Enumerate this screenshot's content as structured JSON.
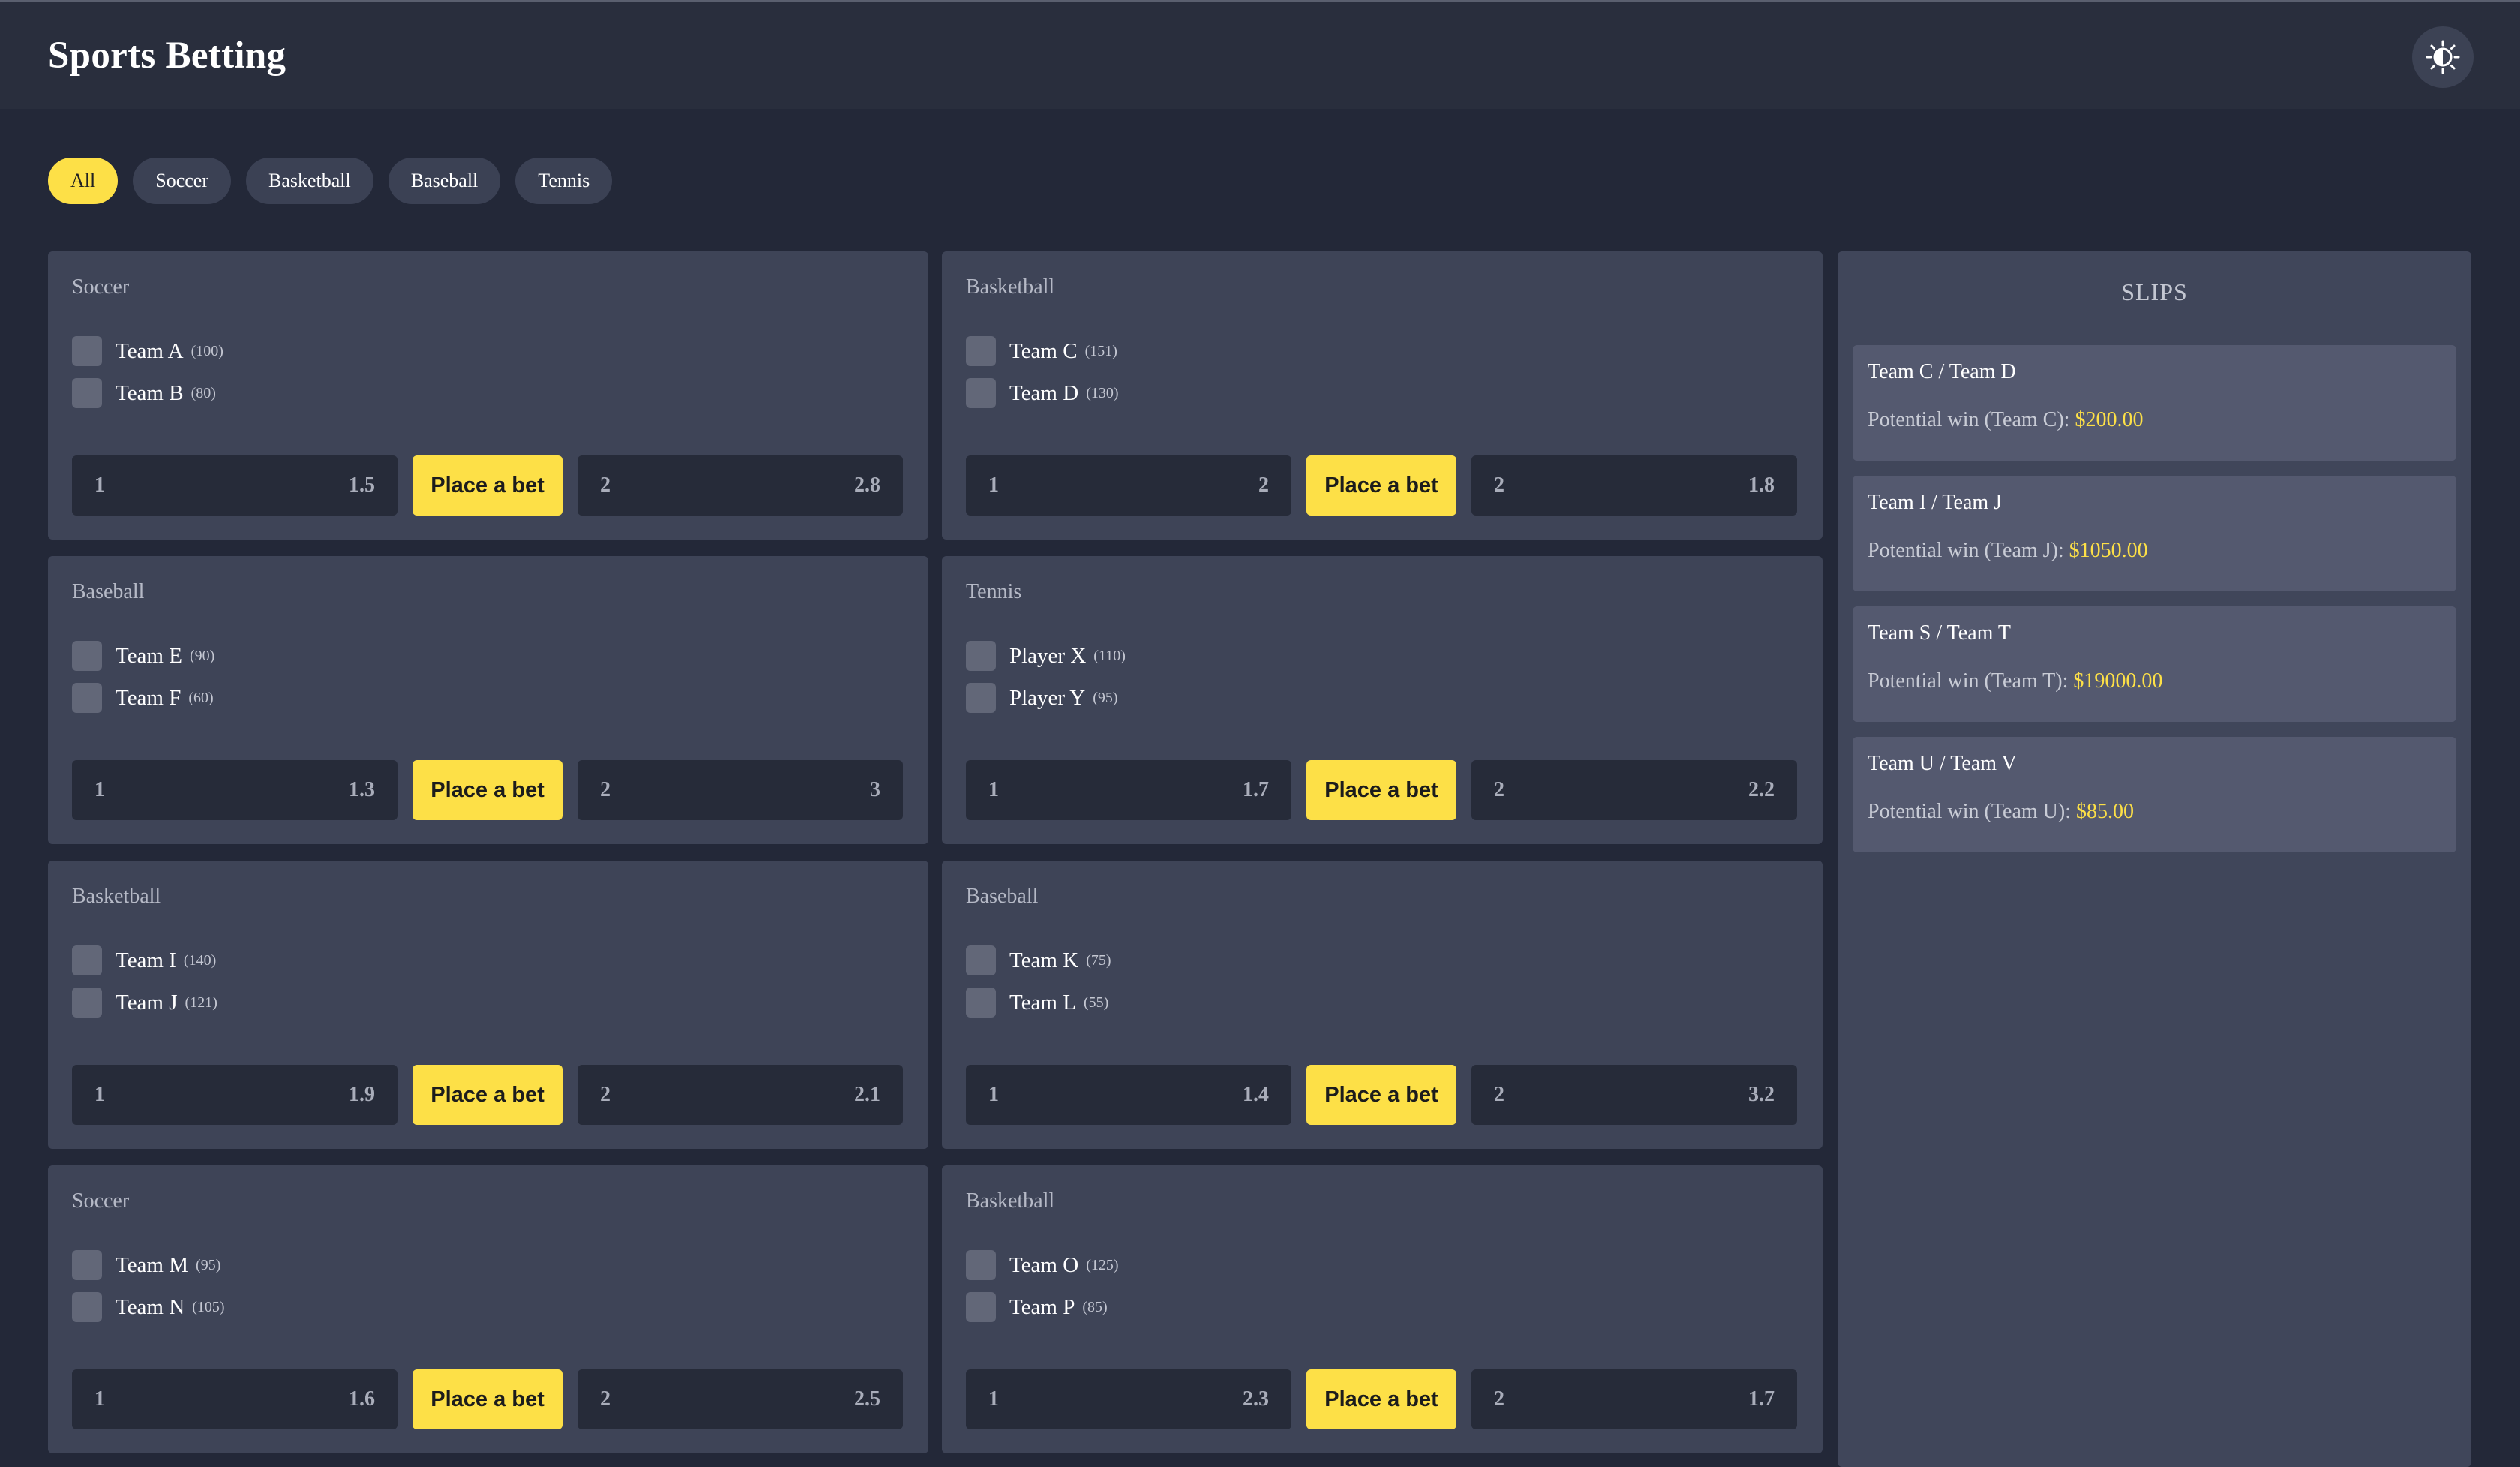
{
  "app": {
    "title": "Sports Betting",
    "theme_icon": "sun-icon"
  },
  "filters": [
    "All",
    "Soccer",
    "Basketball",
    "Baseball",
    "Tennis"
  ],
  "active_filter": "All",
  "place_bet_label": "Place a bet",
  "matches": [
    {
      "sport": "Soccer",
      "team1": "Team A",
      "count1": "(100)",
      "team2": "Team B",
      "count2": "(80)",
      "outcome1": "1",
      "odds1": "1.5",
      "outcome2": "2",
      "odds2": "2.8"
    },
    {
      "sport": "Basketball",
      "team1": "Team C",
      "count1": "(151)",
      "team2": "Team D",
      "count2": "(130)",
      "outcome1": "1",
      "odds1": "2",
      "outcome2": "2",
      "odds2": "1.8"
    },
    {
      "sport": "Baseball",
      "team1": "Team E",
      "count1": "(90)",
      "team2": "Team F",
      "count2": "(60)",
      "outcome1": "1",
      "odds1": "1.3",
      "outcome2": "2",
      "odds2": "3"
    },
    {
      "sport": "Tennis",
      "team1": "Player X",
      "count1": "(110)",
      "team2": "Player Y",
      "count2": "(95)",
      "outcome1": "1",
      "odds1": "1.7",
      "outcome2": "2",
      "odds2": "2.2"
    },
    {
      "sport": "Basketball",
      "team1": "Team I",
      "count1": "(140)",
      "team2": "Team J",
      "count2": "(121)",
      "outcome1": "1",
      "odds1": "1.9",
      "outcome2": "2",
      "odds2": "2.1"
    },
    {
      "sport": "Baseball",
      "team1": "Team K",
      "count1": "(75)",
      "team2": "Team L",
      "count2": "(55)",
      "outcome1": "1",
      "odds1": "1.4",
      "outcome2": "2",
      "odds2": "3.2"
    },
    {
      "sport": "Soccer",
      "team1": "Team M",
      "count1": "(95)",
      "team2": "Team N",
      "count2": "(105)",
      "outcome1": "1",
      "odds1": "1.6",
      "outcome2": "2",
      "odds2": "2.5"
    },
    {
      "sport": "Basketball",
      "team1": "Team O",
      "count1": "(125)",
      "team2": "Team P",
      "count2": "(85)",
      "outcome1": "1",
      "odds1": "2.3",
      "outcome2": "2",
      "odds2": "1.7"
    }
  ],
  "slips": {
    "title": "SLIPS",
    "items": [
      {
        "teams": "Team C / Team D",
        "win_label": "Potential win (Team C): ",
        "amount": "$200.00"
      },
      {
        "teams": "Team I / Team J",
        "win_label": "Potential win (Team J): ",
        "amount": "$1050.00"
      },
      {
        "teams": "Team S / Team T",
        "win_label": "Potential win (Team T): ",
        "amount": "$19000.00"
      },
      {
        "teams": "Team U / Team V",
        "win_label": "Potential win (Team U): ",
        "amount": "$85.00"
      }
    ]
  },
  "colors": {
    "accent": "#fde047",
    "background": "#232838",
    "card": "#3e4457",
    "slip": "#54596f"
  }
}
